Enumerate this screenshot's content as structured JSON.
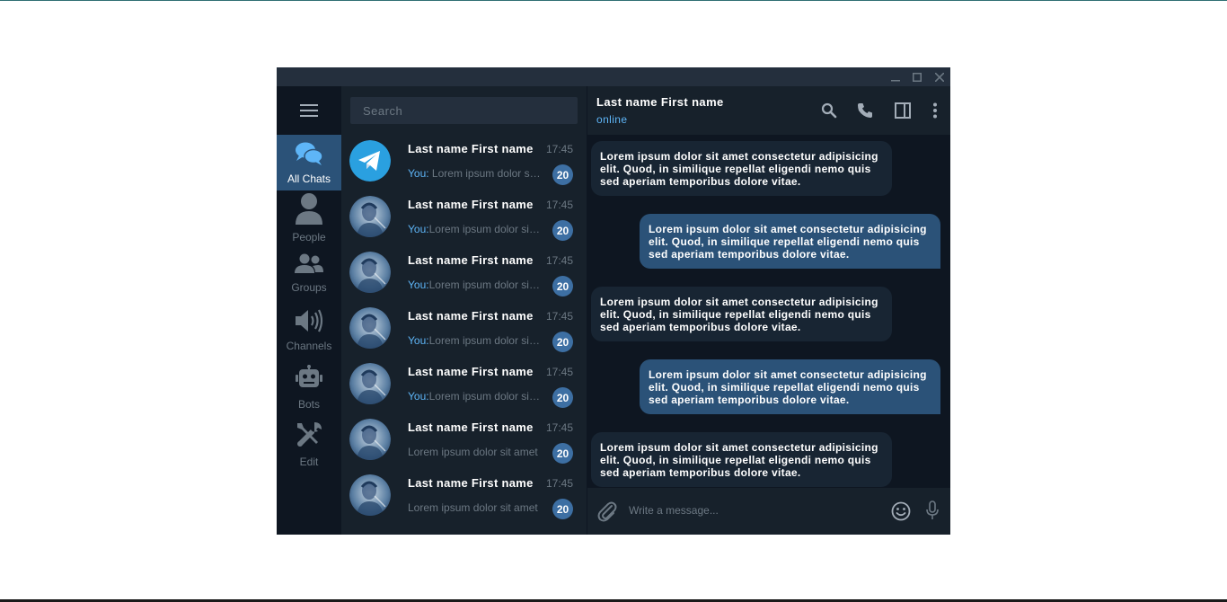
{
  "colors": {
    "window_bg": "#17212b",
    "sidebar_bg": "#0e1621",
    "accent": "#5eb5f7",
    "active_nav": "#2b5278",
    "badge": "#3d6fa3",
    "outgoing_bubble": "#2b5278",
    "incoming_bubble": "#182533"
  },
  "window_controls": [
    "minimize-icon",
    "maximize-icon",
    "close-icon"
  ],
  "sidebar": {
    "menu_icon": "hamburger-menu-icon",
    "items": [
      {
        "label": "All Chats",
        "icon": "chat-bubbles-icon",
        "active": true
      },
      {
        "label": "People",
        "icon": "person-icon",
        "active": false
      },
      {
        "label": "Groups",
        "icon": "group-icon",
        "active": false
      },
      {
        "label": "Channels",
        "icon": "speaker-icon",
        "active": false
      },
      {
        "label": "Bots",
        "icon": "robot-icon",
        "active": false
      },
      {
        "label": "Edit",
        "icon": "tools-icon",
        "active": false
      }
    ]
  },
  "search": {
    "placeholder": "Search"
  },
  "chats": [
    {
      "name": "Last name First name",
      "time": "17:45",
      "you": "You: ",
      "preview": "Lorem ipsum dolor sit amet",
      "unread": "20",
      "avatar": "telegram-logo"
    },
    {
      "name": "Last name First name",
      "time": "17:45",
      "you": "You:",
      "preview": "Lorem ipsum dolor sit amet",
      "unread": "20",
      "avatar": "photo"
    },
    {
      "name": "Last name First name",
      "time": "17:45",
      "you": "You:",
      "preview": "Lorem ipsum dolor sit amet",
      "unread": "20",
      "avatar": "photo"
    },
    {
      "name": "Last name First name",
      "time": "17:45",
      "you": "You:",
      "preview": "Lorem ipsum dolor sit amet",
      "unread": "20",
      "avatar": "photo"
    },
    {
      "name": "Last name First name",
      "time": "17:45",
      "you": "You:",
      "preview": "Lorem ipsum dolor sit amet",
      "unread": "20",
      "avatar": "photo"
    },
    {
      "name": "Last name First name",
      "time": "17:45",
      "you": "",
      "preview": "Lorem ipsum dolor sit amet",
      "unread": "20",
      "avatar": "photo"
    },
    {
      "name": "Last name First name",
      "time": "17:45",
      "you": "",
      "preview": "Lorem ipsum dolor sit amet",
      "unread": "20",
      "avatar": "photo"
    }
  ],
  "conversation": {
    "name": "Last name First name",
    "status": "online",
    "header_icons": [
      "search-icon",
      "phone-icon",
      "side-panel-icon",
      "more-vertical-icon"
    ],
    "messages": [
      {
        "direction": "in",
        "text": "Lorem ipsum dolor sit amet consectetur adipisicing elit. Quod, in similique repellat eligendi nemo quis sed aperiam temporibus dolore vitae."
      },
      {
        "direction": "out",
        "text": "Lorem ipsum dolor sit amet consectetur adipisicing elit. Quod, in similique repellat eligendi nemo quis sed aperiam temporibus dolore vitae."
      },
      {
        "direction": "in",
        "text": "Lorem ipsum dolor sit amet consectetur adipisicing elit. Quod, in similique repellat eligendi nemo quis sed aperiam temporibus dolore vitae."
      },
      {
        "direction": "out",
        "text": "Lorem ipsum dolor sit amet consectetur adipisicing elit. Quod, in similique repellat eligendi nemo quis sed aperiam temporibus dolore vitae."
      },
      {
        "direction": "in",
        "text": "Lorem ipsum dolor sit amet consectetur adipisicing elit. Quod, in similique repellat eligendi nemo quis sed aperiam temporibus dolore vitae."
      }
    ],
    "composer": {
      "placeholder": "Write a message...",
      "icons": [
        "paperclip-icon",
        "emoji-icon",
        "microphone-icon"
      ]
    }
  }
}
